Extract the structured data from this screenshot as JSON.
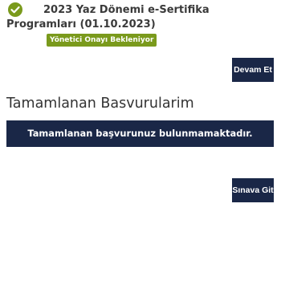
{
  "program": {
    "icon": "check-circle-icon",
    "title": "2023 Yaz Dönemi e-Sertifika",
    "subtitle": "Programları (01.10.2023)",
    "status_badge": "Yönetici Onayı Bekleniyor"
  },
  "actions": {
    "continue_label": "Devam Et",
    "exam_label": "Sınava Git"
  },
  "applications": {
    "section_title": "Tamamlanan Basvurularim",
    "empty_message": "Tamamlanan başvurunuz bulunmamaktadır."
  },
  "colors": {
    "accent": "#7a9a1c",
    "button": "#1a2747",
    "text": "#333333"
  }
}
